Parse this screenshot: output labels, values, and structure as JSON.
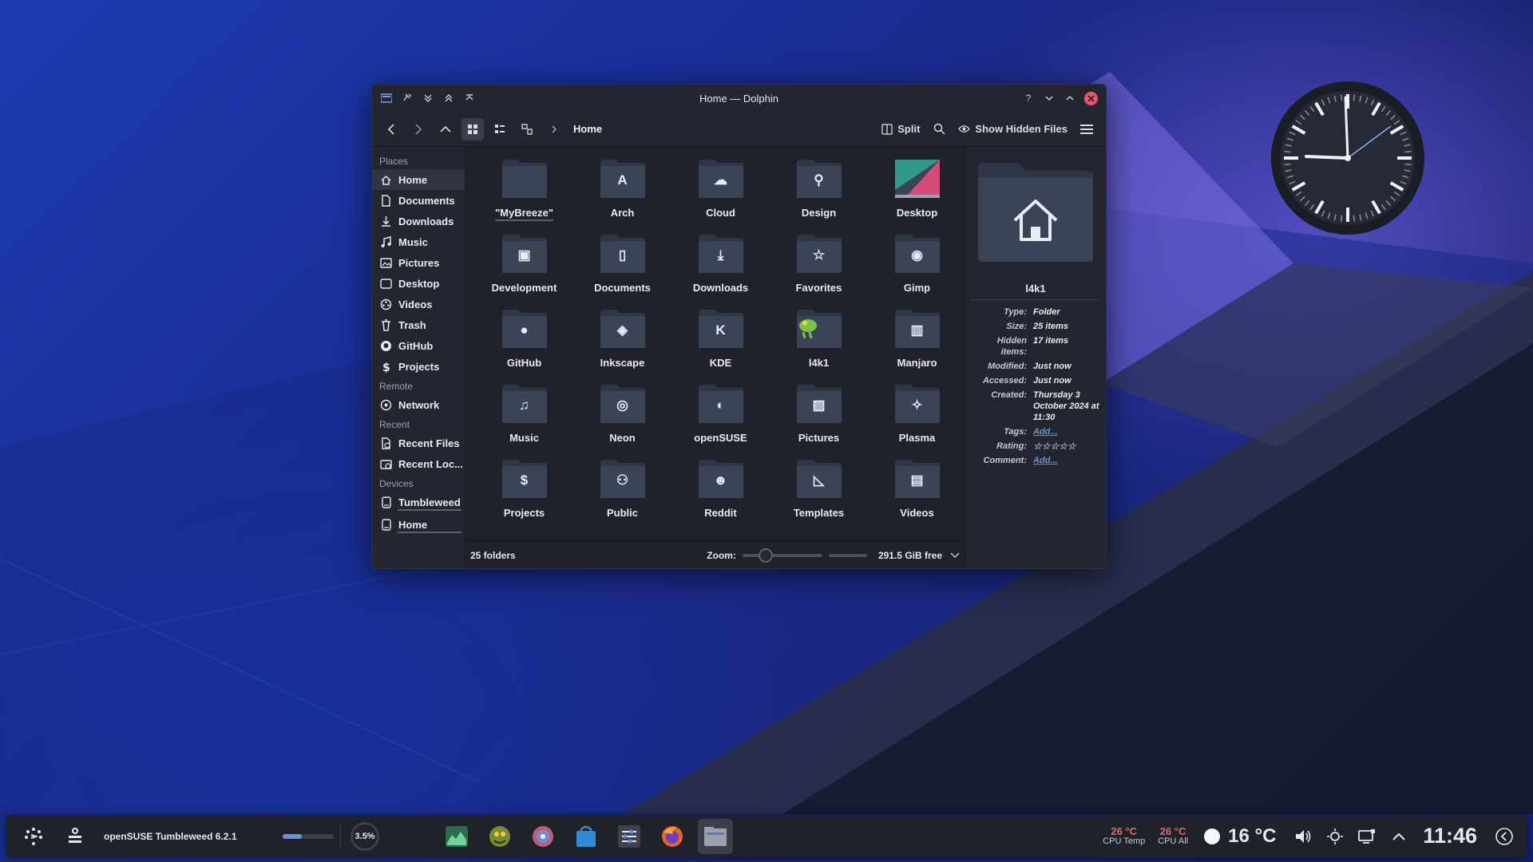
{
  "window": {
    "title": "Home — Dolphin"
  },
  "toolbar": {
    "breadcrumb": "Home",
    "split_label": "Split",
    "hidden_label": "Show Hidden Files"
  },
  "sidebar": {
    "sections": [
      {
        "title": "Places",
        "items": [
          {
            "label": "Home",
            "icon": "home-icon"
          },
          {
            "label": "Documents",
            "icon": "document-icon"
          },
          {
            "label": "Downloads",
            "icon": "download-icon"
          },
          {
            "label": "Music",
            "icon": "music-icon"
          },
          {
            "label": "Pictures",
            "icon": "picture-icon"
          },
          {
            "label": "Desktop",
            "icon": "desktop-icon"
          },
          {
            "label": "Videos",
            "icon": "video-icon"
          },
          {
            "label": "Trash",
            "icon": "trash-icon"
          },
          {
            "label": "GitHub",
            "icon": "github-icon"
          },
          {
            "label": "Projects",
            "icon": "dollar-icon"
          }
        ]
      },
      {
        "title": "Remote",
        "items": [
          {
            "label": "Network",
            "icon": "network-icon"
          }
        ]
      },
      {
        "title": "Recent",
        "items": [
          {
            "label": "Recent Files",
            "icon": "recent-files-icon"
          },
          {
            "label": "Recent Loc...",
            "icon": "recent-locations-icon"
          }
        ]
      },
      {
        "title": "Devices",
        "items": [
          {
            "label": "Tumbleweed",
            "icon": "drive-icon"
          },
          {
            "label": "Home",
            "icon": "drive-icon"
          }
        ]
      }
    ]
  },
  "folders": [
    {
      "name": "\"MyBreeze\"",
      "glyph": ""
    },
    {
      "name": "Arch",
      "glyph": "A"
    },
    {
      "name": "Cloud",
      "glyph": "☁"
    },
    {
      "name": "Design",
      "glyph": "⚲"
    },
    {
      "name": "Desktop",
      "glyph": ""
    },
    {
      "name": "Development",
      "glyph": "▣"
    },
    {
      "name": "Documents",
      "glyph": "▯"
    },
    {
      "name": "Downloads",
      "glyph": "⤓"
    },
    {
      "name": "Favorites",
      "glyph": "☆"
    },
    {
      "name": "Gimp",
      "glyph": "◉"
    },
    {
      "name": "GitHub",
      "glyph": "●"
    },
    {
      "name": "Inkscape",
      "glyph": "◈"
    },
    {
      "name": "KDE",
      "glyph": "K"
    },
    {
      "name": "l4k1",
      "glyph": ""
    },
    {
      "name": "Manjaro",
      "glyph": "▥"
    },
    {
      "name": "Music",
      "glyph": "♫"
    },
    {
      "name": "Neon",
      "glyph": "◎"
    },
    {
      "name": "openSUSE",
      "glyph": "◐"
    },
    {
      "name": "Pictures",
      "glyph": "▨"
    },
    {
      "name": "Plasma",
      "glyph": "✧"
    },
    {
      "name": "Projects",
      "glyph": "$"
    },
    {
      "name": "Public",
      "glyph": "⚇"
    },
    {
      "name": "Reddit",
      "glyph": "☻"
    },
    {
      "name": "Templates",
      "glyph": "◺"
    },
    {
      "name": "Videos",
      "glyph": "▤"
    }
  ],
  "status": {
    "count": "25 folders",
    "zoom_label": "Zoom:",
    "zoom_level": 0.2,
    "free": "291.5 GiB free"
  },
  "info": {
    "name": "l4k1",
    "props": [
      {
        "label": "Type:",
        "value": "Folder"
      },
      {
        "label": "Size:",
        "value": "25 items"
      },
      {
        "label": "Hidden items:",
        "value": "17 items"
      },
      {
        "label": "Modified:",
        "value": "Just now"
      },
      {
        "label": "Accessed:",
        "value": "Just now"
      },
      {
        "label": "Created:",
        "value": "Thursday 3 October 2024 at 11:30"
      },
      {
        "label": "Tags:",
        "value": "Add...",
        "link": true
      },
      {
        "label": "Rating:",
        "value": "",
        "stars": 5
      },
      {
        "label": "Comment:",
        "value": "Add...",
        "link": true
      }
    ]
  },
  "taskbar": {
    "os_label": "openSUSE Tumbleweed 6.2.1",
    "cpu_percent": "3.5%",
    "cpu_temp_value": "26 °C",
    "cpu_temp_label": "CPU Temp",
    "cpu_all_value": "26 °C",
    "cpu_all_label": "CPU All",
    "weather": "16 °C",
    "time": "11:46"
  },
  "colors": {
    "accent": "#6f8fd8",
    "close": "#e9576e",
    "folder": "#3b4456"
  }
}
